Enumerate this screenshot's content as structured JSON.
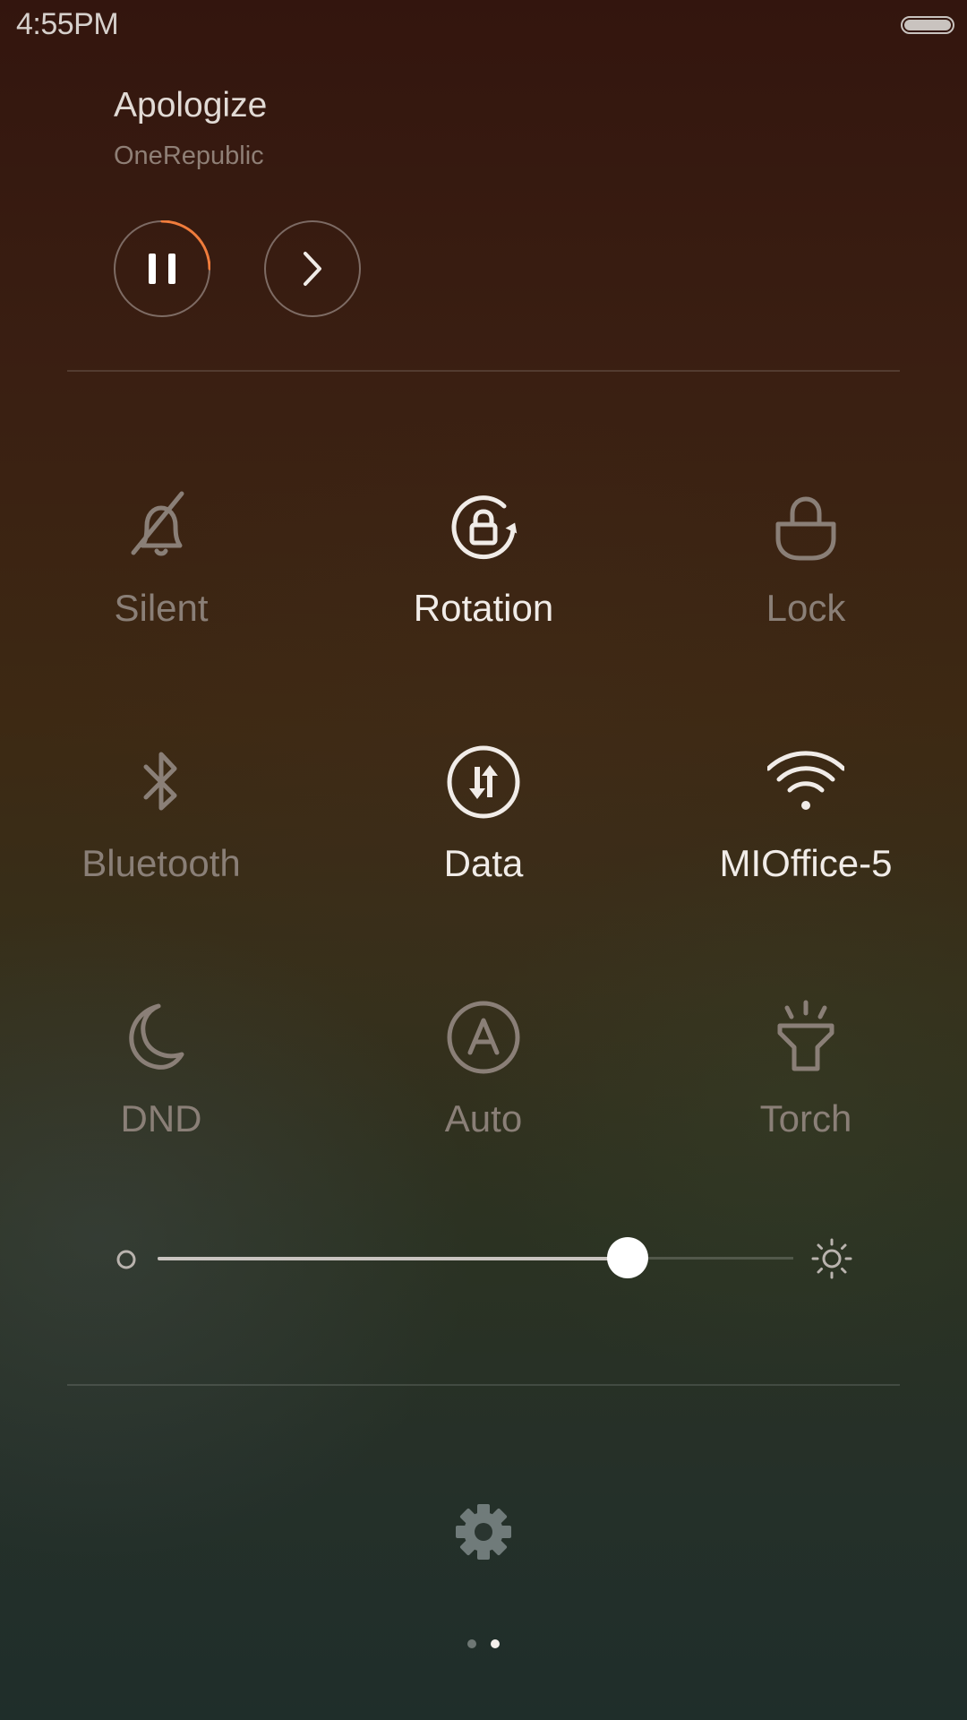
{
  "status_bar": {
    "time": "4:55PM",
    "battery_level": 1.0
  },
  "media": {
    "title": "Apologize",
    "artist": "OneRepublic",
    "progress": 0.25,
    "accent_color": "#f07c3c"
  },
  "toggles": [
    {
      "label": "Silent",
      "icon": "bell-off-icon",
      "active": false
    },
    {
      "label": "Rotation",
      "icon": "rotation-lock-icon",
      "active": true
    },
    {
      "label": "Lock",
      "icon": "lock-icon",
      "active": false
    },
    {
      "label": "Bluetooth",
      "icon": "bluetooth-icon",
      "active": false
    },
    {
      "label": "Data",
      "icon": "mobile-data-icon",
      "active": true
    },
    {
      "label": "MIOffice-5",
      "icon": "wifi-icon",
      "active": true
    },
    {
      "label": "DND",
      "icon": "moon-icon",
      "active": false
    },
    {
      "label": "Auto",
      "icon": "auto-brightness-icon",
      "active": false
    },
    {
      "label": "Torch",
      "icon": "flashlight-icon",
      "active": false
    }
  ],
  "brightness": {
    "level": 0.74
  },
  "settings": {
    "icon": "gear-icon"
  },
  "pager": {
    "pages": 2,
    "current": 2
  }
}
